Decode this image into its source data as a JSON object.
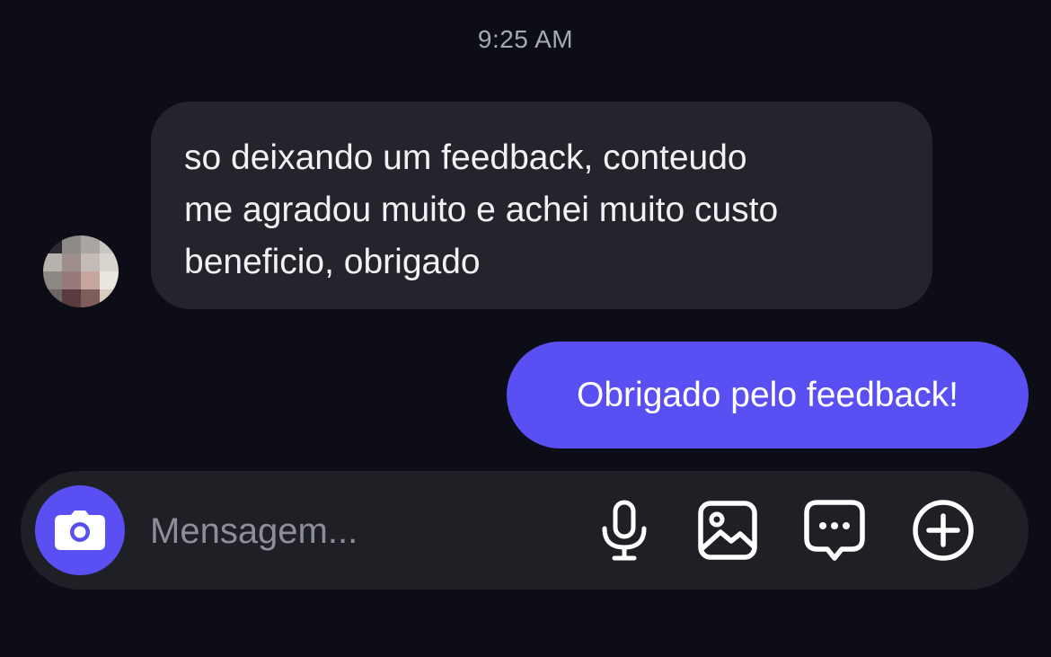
{
  "conversation": {
    "timestamp": "9:25 AM",
    "messages": [
      {
        "direction": "incoming",
        "lines": [
          "so deixando um feedback, conteudo",
          "me agradou muito e achei muito custo",
          "beneficio, obrigado"
        ]
      },
      {
        "direction": "outgoing",
        "text": "Obrigado pelo feedback!"
      }
    ]
  },
  "composer": {
    "placeholder": "Mensagem...",
    "icons": [
      "camera-icon",
      "microphone-icon",
      "image-icon",
      "sticker-chat-icon",
      "plus-icon"
    ]
  },
  "colors": {
    "background": "#0c0d16",
    "incoming_bubble": "#24252c",
    "outgoing_bubble": "#5a4ff2",
    "composer_bg": "#1f2026",
    "timestamp_text": "#a7a9b2"
  }
}
